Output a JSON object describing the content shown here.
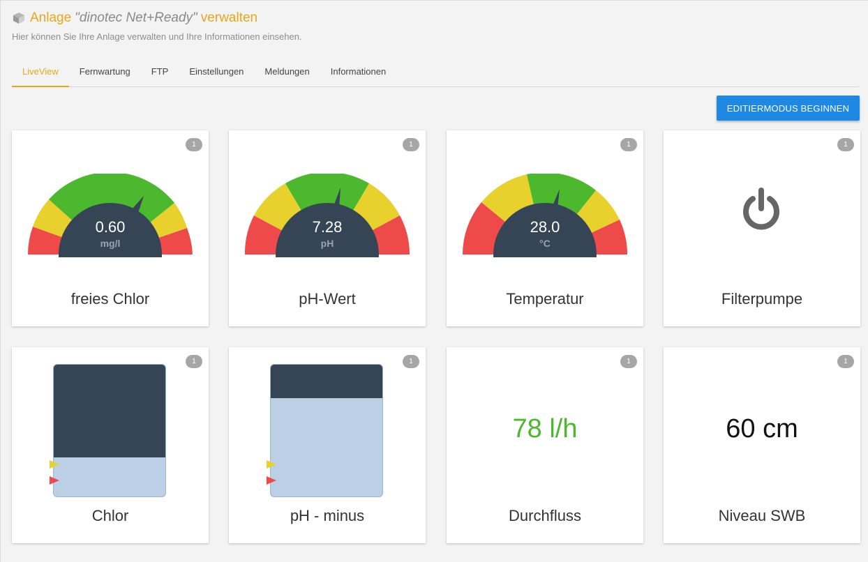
{
  "header": {
    "title_prefix": "Anlage",
    "title_name": "\"dinotec Net+Ready\"",
    "title_suffix": "verwalten",
    "subtitle": "Hier können Sie Ihre Anlage verwalten und Ihre Informationen einsehen."
  },
  "tabs": [
    {
      "label": "LiveView",
      "active": true
    },
    {
      "label": "Fernwartung"
    },
    {
      "label": "FTP"
    },
    {
      "label": "Einstellungen"
    },
    {
      "label": "Meldungen"
    },
    {
      "label": "Informationen"
    }
  ],
  "edit_button": "Editiermodus beginnen",
  "colors": {
    "accent": "#e6a817",
    "button": "#1e88e5",
    "gauge_red": "#ef4a4a",
    "gauge_yellow": "#e8d12c",
    "gauge_green": "#4cb82e",
    "gauge_hub": "#364556",
    "flow_green": "#4cb82e"
  },
  "cards": {
    "chlor_gauge": {
      "badge": "1",
      "value": "0.60",
      "unit": "mg/l",
      "label": "freies Chlor"
    },
    "ph_gauge": {
      "badge": "1",
      "value": "7.28",
      "unit": "pH",
      "label": "pH-Wert"
    },
    "temp_gauge": {
      "badge": "1",
      "value": "28.0",
      "unit": "°C",
      "label": "Temperatur"
    },
    "pump": {
      "badge": "1",
      "icon": "power-icon",
      "label": "Filterpumpe"
    },
    "chlor_tank": {
      "badge": "1",
      "fill_level": 0.3,
      "label": "Chlor"
    },
    "ph_minus_tank": {
      "badge": "1",
      "fill_level": 0.75,
      "label": "pH - minus"
    },
    "flow": {
      "badge": "1",
      "value": "78 l/h",
      "label": "Durchfluss"
    },
    "level": {
      "badge": "1",
      "value": "60 cm",
      "label": "Niveau SWB"
    }
  }
}
